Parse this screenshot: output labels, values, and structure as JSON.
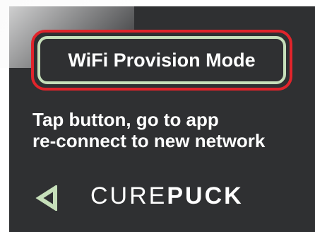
{
  "provision_button": {
    "label": "WiFi Provision Mode"
  },
  "instructions": {
    "line1": "Tap button, go to app",
    "line2": "re-connect to new network"
  },
  "footer": {
    "back_icon": "triangle-left-icon",
    "brand_light": "CURE",
    "brand_bold": "PUCK"
  },
  "colors": {
    "background": "#2f3032",
    "button_outer_border": "#e0242b",
    "button_inner_border": "#c6dfba",
    "back_icon": "#c6dfba",
    "text": "#ffffff"
  }
}
